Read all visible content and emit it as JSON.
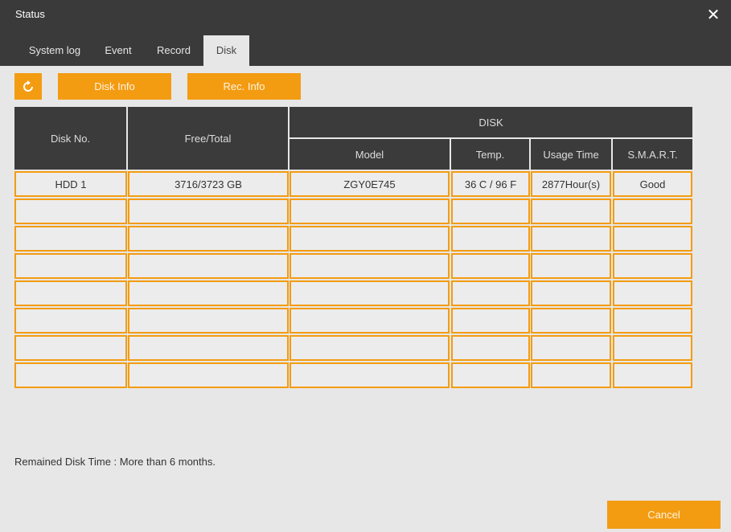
{
  "window": {
    "title": "Status",
    "close_icon": "close-icon"
  },
  "tabs": [
    {
      "label": "System log",
      "active": false
    },
    {
      "label": "Event",
      "active": false
    },
    {
      "label": "Record",
      "active": false
    },
    {
      "label": "Disk",
      "active": true
    }
  ],
  "toolbar": {
    "refresh_icon": "refresh-icon",
    "disk_info_label": "Disk Info",
    "rec_info_label": "Rec. Info"
  },
  "table": {
    "headers": {
      "disk_no": "Disk No.",
      "free_total": "Free/Total",
      "disk_group": "DISK",
      "model": "Model",
      "temp": "Temp.",
      "usage_time": "Usage Time",
      "smart": "S.M.A.R.T."
    },
    "rows": [
      [
        "HDD 1",
        "3716/3723 GB",
        "ZGY0E745",
        "36 C / 96 F",
        "2877Hour(s)",
        "Good"
      ],
      [
        "",
        "",
        "",
        "",
        "",
        ""
      ],
      [
        "",
        "",
        "",
        "",
        "",
        ""
      ],
      [
        "",
        "",
        "",
        "",
        "",
        ""
      ],
      [
        "",
        "",
        "",
        "",
        "",
        ""
      ],
      [
        "",
        "",
        "",
        "",
        "",
        ""
      ],
      [
        "",
        "",
        "",
        "",
        "",
        ""
      ],
      [
        "",
        "",
        "",
        "",
        "",
        ""
      ]
    ]
  },
  "footer": {
    "remained_text": "Remained Disk Time : More than 6 months.",
    "cancel_label": "Cancel"
  },
  "colors": {
    "accent": "#f39c12",
    "titlebar": "#3a3a3a",
    "header": "#3b3b3b",
    "background": "#e7e7e7"
  }
}
